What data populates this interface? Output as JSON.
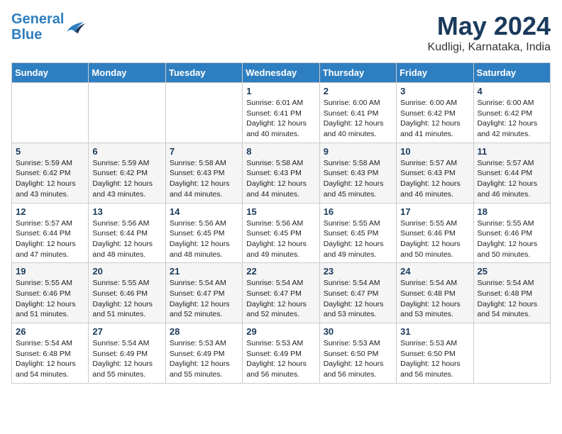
{
  "header": {
    "logo_line1": "General",
    "logo_line2": "Blue",
    "month_title": "May 2024",
    "location": "Kudligi, Karnataka, India"
  },
  "days_of_week": [
    "Sunday",
    "Monday",
    "Tuesday",
    "Wednesday",
    "Thursday",
    "Friday",
    "Saturday"
  ],
  "weeks": [
    [
      {
        "day": "",
        "info": ""
      },
      {
        "day": "",
        "info": ""
      },
      {
        "day": "",
        "info": ""
      },
      {
        "day": "1",
        "info": "Sunrise: 6:01 AM\nSunset: 6:41 PM\nDaylight: 12 hours\nand 40 minutes."
      },
      {
        "day": "2",
        "info": "Sunrise: 6:00 AM\nSunset: 6:41 PM\nDaylight: 12 hours\nand 40 minutes."
      },
      {
        "day": "3",
        "info": "Sunrise: 6:00 AM\nSunset: 6:42 PM\nDaylight: 12 hours\nand 41 minutes."
      },
      {
        "day": "4",
        "info": "Sunrise: 6:00 AM\nSunset: 6:42 PM\nDaylight: 12 hours\nand 42 minutes."
      }
    ],
    [
      {
        "day": "5",
        "info": "Sunrise: 5:59 AM\nSunset: 6:42 PM\nDaylight: 12 hours\nand 43 minutes."
      },
      {
        "day": "6",
        "info": "Sunrise: 5:59 AM\nSunset: 6:42 PM\nDaylight: 12 hours\nand 43 minutes."
      },
      {
        "day": "7",
        "info": "Sunrise: 5:58 AM\nSunset: 6:43 PM\nDaylight: 12 hours\nand 44 minutes."
      },
      {
        "day": "8",
        "info": "Sunrise: 5:58 AM\nSunset: 6:43 PM\nDaylight: 12 hours\nand 44 minutes."
      },
      {
        "day": "9",
        "info": "Sunrise: 5:58 AM\nSunset: 6:43 PM\nDaylight: 12 hours\nand 45 minutes."
      },
      {
        "day": "10",
        "info": "Sunrise: 5:57 AM\nSunset: 6:43 PM\nDaylight: 12 hours\nand 46 minutes."
      },
      {
        "day": "11",
        "info": "Sunrise: 5:57 AM\nSunset: 6:44 PM\nDaylight: 12 hours\nand 46 minutes."
      }
    ],
    [
      {
        "day": "12",
        "info": "Sunrise: 5:57 AM\nSunset: 6:44 PM\nDaylight: 12 hours\nand 47 minutes."
      },
      {
        "day": "13",
        "info": "Sunrise: 5:56 AM\nSunset: 6:44 PM\nDaylight: 12 hours\nand 48 minutes."
      },
      {
        "day": "14",
        "info": "Sunrise: 5:56 AM\nSunset: 6:45 PM\nDaylight: 12 hours\nand 48 minutes."
      },
      {
        "day": "15",
        "info": "Sunrise: 5:56 AM\nSunset: 6:45 PM\nDaylight: 12 hours\nand 49 minutes."
      },
      {
        "day": "16",
        "info": "Sunrise: 5:55 AM\nSunset: 6:45 PM\nDaylight: 12 hours\nand 49 minutes."
      },
      {
        "day": "17",
        "info": "Sunrise: 5:55 AM\nSunset: 6:46 PM\nDaylight: 12 hours\nand 50 minutes."
      },
      {
        "day": "18",
        "info": "Sunrise: 5:55 AM\nSunset: 6:46 PM\nDaylight: 12 hours\nand 50 minutes."
      }
    ],
    [
      {
        "day": "19",
        "info": "Sunrise: 5:55 AM\nSunset: 6:46 PM\nDaylight: 12 hours\nand 51 minutes."
      },
      {
        "day": "20",
        "info": "Sunrise: 5:55 AM\nSunset: 6:46 PM\nDaylight: 12 hours\nand 51 minutes."
      },
      {
        "day": "21",
        "info": "Sunrise: 5:54 AM\nSunset: 6:47 PM\nDaylight: 12 hours\nand 52 minutes."
      },
      {
        "day": "22",
        "info": "Sunrise: 5:54 AM\nSunset: 6:47 PM\nDaylight: 12 hours\nand 52 minutes."
      },
      {
        "day": "23",
        "info": "Sunrise: 5:54 AM\nSunset: 6:47 PM\nDaylight: 12 hours\nand 53 minutes."
      },
      {
        "day": "24",
        "info": "Sunrise: 5:54 AM\nSunset: 6:48 PM\nDaylight: 12 hours\nand 53 minutes."
      },
      {
        "day": "25",
        "info": "Sunrise: 5:54 AM\nSunset: 6:48 PM\nDaylight: 12 hours\nand 54 minutes."
      }
    ],
    [
      {
        "day": "26",
        "info": "Sunrise: 5:54 AM\nSunset: 6:48 PM\nDaylight: 12 hours\nand 54 minutes."
      },
      {
        "day": "27",
        "info": "Sunrise: 5:54 AM\nSunset: 6:49 PM\nDaylight: 12 hours\nand 55 minutes."
      },
      {
        "day": "28",
        "info": "Sunrise: 5:53 AM\nSunset: 6:49 PM\nDaylight: 12 hours\nand 55 minutes."
      },
      {
        "day": "29",
        "info": "Sunrise: 5:53 AM\nSunset: 6:49 PM\nDaylight: 12 hours\nand 56 minutes."
      },
      {
        "day": "30",
        "info": "Sunrise: 5:53 AM\nSunset: 6:50 PM\nDaylight: 12 hours\nand 56 minutes."
      },
      {
        "day": "31",
        "info": "Sunrise: 5:53 AM\nSunset: 6:50 PM\nDaylight: 12 hours\nand 56 minutes."
      },
      {
        "day": "",
        "info": ""
      }
    ]
  ]
}
